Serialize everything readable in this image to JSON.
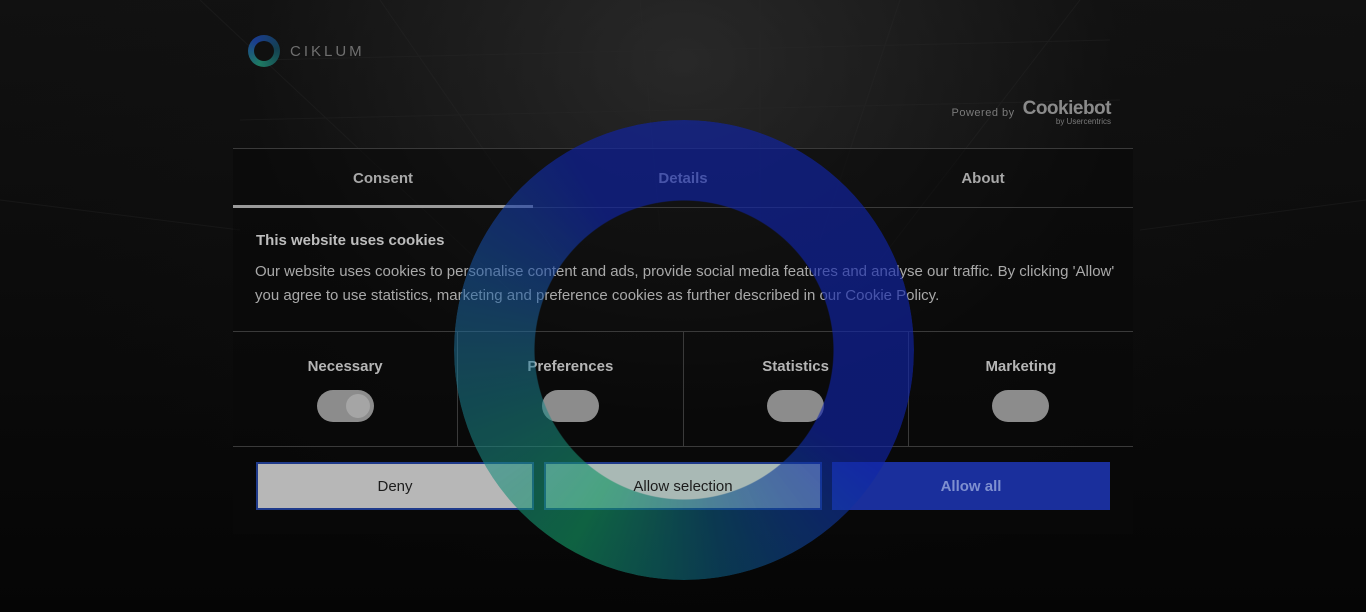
{
  "brand": {
    "logo_text": "CIKLUM"
  },
  "powered_by": {
    "label": "Powered by",
    "name": "Cookiebot",
    "sub": "by Usercentrics"
  },
  "tabs": [
    {
      "label": "Consent",
      "active": true
    },
    {
      "label": "Details",
      "active": false
    },
    {
      "label": "About",
      "active": false
    }
  ],
  "consent": {
    "title": "This website uses cookies",
    "text": "Our website uses cookies to personalise content and ads, provide social media features and analyse our traffic. By clicking 'Allow' you agree to use statistics, marketing and preference cookies as further described in our Cookie Policy."
  },
  "toggles": [
    {
      "label": "Necessary",
      "state": "on"
    },
    {
      "label": "Preferences",
      "state": "off"
    },
    {
      "label": "Statistics",
      "state": "off"
    },
    {
      "label": "Marketing",
      "state": "off"
    }
  ],
  "buttons": {
    "deny": "Deny",
    "allow_selection": "Allow selection",
    "allow_all": "Allow all"
  },
  "colors": {
    "accent": "#1a2f9c",
    "background": "#070707",
    "spinner_green": "#14966a"
  },
  "icons": {
    "logo": "ciklum-ring-logo",
    "loading": "loading-ring-icon"
  }
}
